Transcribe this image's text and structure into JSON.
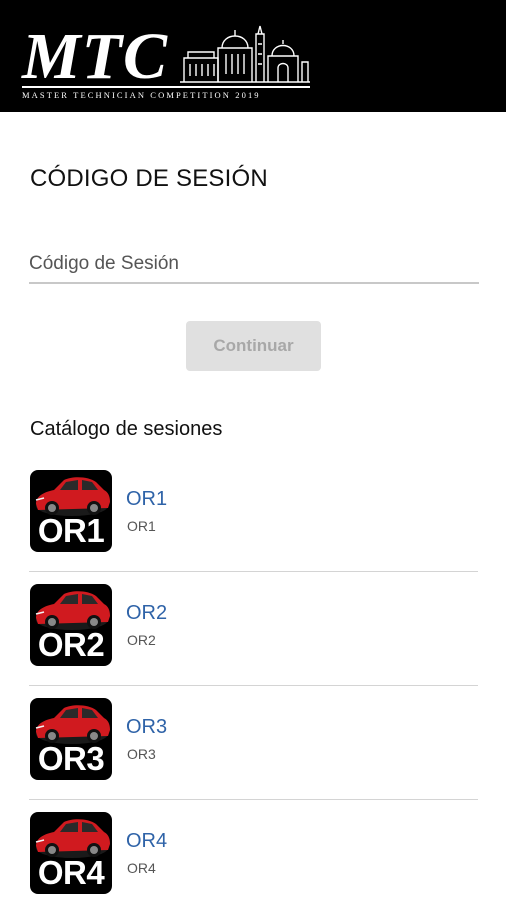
{
  "header": {
    "logo_text": "MTC",
    "logo_subtitle": "MASTER TECHNICIAN COMPETITION 2019"
  },
  "page": {
    "title": "CÓDIGO DE SESIÓN"
  },
  "form": {
    "code_placeholder": "Código de Sesión",
    "code_value": "",
    "continue_label": "Continuar",
    "continue_disabled": true
  },
  "catalog": {
    "title": "Catálogo de sesiones",
    "sessions": [
      {
        "thumb_label": "OR1",
        "title": "OR1",
        "subtitle": "OR1"
      },
      {
        "thumb_label": "OR2",
        "title": "OR2",
        "subtitle": "OR2"
      },
      {
        "thumb_label": "OR3",
        "title": "OR3",
        "subtitle": "OR3"
      },
      {
        "thumb_label": "OR4",
        "title": "OR4",
        "subtitle": "OR4"
      }
    ]
  },
  "colors": {
    "header_bg": "#000000",
    "link": "#2f63a8",
    "button_disabled_bg": "#e0e0e0",
    "button_disabled_text": "#a8a8a8",
    "car_red": "#d01a1f"
  },
  "icons": {
    "logo": "mtc-building-logo",
    "session_thumbnail": "red-car-thumbnail"
  }
}
